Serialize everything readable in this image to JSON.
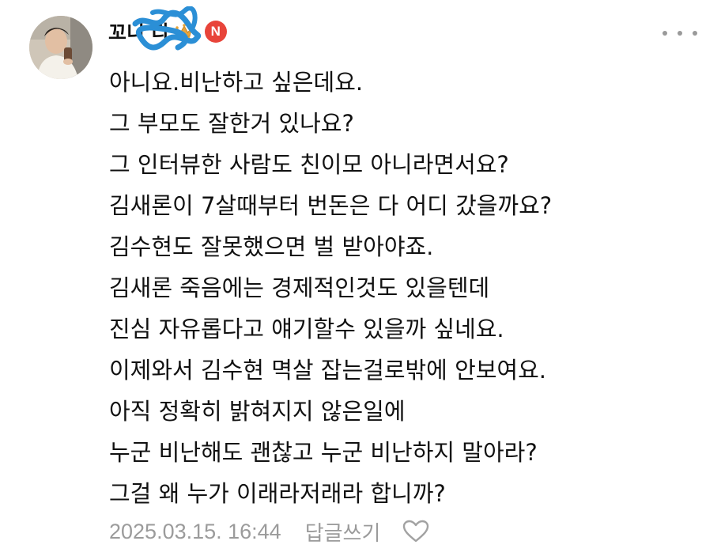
{
  "comment": {
    "author_name": "꼬니 다",
    "badge_label": "N",
    "accent_color": "#e8443a",
    "crown_color": "#e7a53a",
    "redaction_color": "#2b8fd6",
    "lines": [
      "아니요.비난하고 싶은데요.",
      "그 부모도 잘한거 있나요?",
      "그 인터뷰한 사람도 친이모 아니라면서요?",
      "김새론이 7살때부터 번돈은 다 어디 갔을까요?",
      "김수현도 잘못했으면 벌 받아야죠.",
      "김새론 죽음에는 경제적인것도 있을텐데",
      "진심 자유롭다고 얘기할수 있을까 싶네요.",
      "이제와서 김수현 멱살 잡는걸로밖에 안보여요.",
      "아직 정확히 밝혀지지 않은일에",
      "누군 비난해도 괜찮고 누군 비난하지 말아라?",
      "그걸 왜 누가 이래라저래라 합니까?"
    ],
    "timestamp": "2025.03.15. 16:44",
    "reply_label": "답글쓰기",
    "icons": {
      "avatar": "profile-photo",
      "crown": "crown-icon",
      "more": "more-horizontal-icon",
      "like": "heart-outline-icon"
    }
  }
}
